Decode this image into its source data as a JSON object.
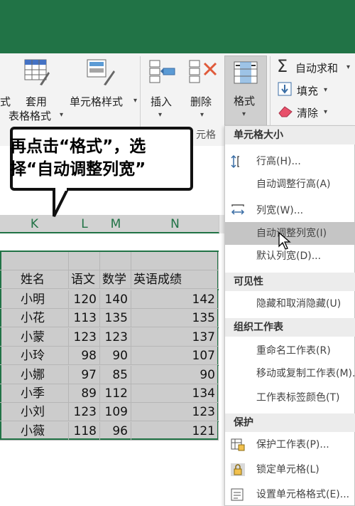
{
  "ribbon": {
    "partial_left": "式",
    "table_format_line1": "套用",
    "table_format_line2": "表格格式",
    "cell_styles": "单元格样式",
    "insert": "插入",
    "delete": "删除",
    "format": "格式",
    "autosum": "自动求和",
    "fill": "填充",
    "clear": "清除",
    "group_cells_partial": "元格"
  },
  "callout": {
    "line1": "再点击“格式”，选",
    "line2": "择“自动调整列宽”"
  },
  "columns": [
    "K",
    "L",
    "M",
    "N"
  ],
  "table": {
    "headers": [
      "姓名",
      "语文",
      "数学",
      "英语成绩"
    ],
    "rows": [
      {
        "name": "小明",
        "chinese": "120",
        "math": "140",
        "english": "142"
      },
      {
        "name": "小花",
        "chinese": "113",
        "math": "135",
        "english": "135"
      },
      {
        "name": "小蒙",
        "chinese": "123",
        "math": "123",
        "english": "137"
      },
      {
        "name": "小玲",
        "chinese": "98",
        "math": "90",
        "english": "107"
      },
      {
        "name": "小娜",
        "chinese": "97",
        "math": "85",
        "english": "90"
      },
      {
        "name": "小季",
        "chinese": "89",
        "math": "112",
        "english": "134"
      },
      {
        "name": "小刘",
        "chinese": "123",
        "math": "109",
        "english": "123"
      },
      {
        "name": "小薇",
        "chinese": "118",
        "math": "96",
        "english": "121"
      }
    ]
  },
  "menu": {
    "section_cell_size": "单元格大小",
    "row_height": "行高(H)...",
    "autofit_row_height": "自动调整行高(A)",
    "column_width": "列宽(W)...",
    "autofit_column_width": "自动调整列宽(I)",
    "default_width": "默认列宽(D)...",
    "section_visibility": "可见性",
    "hide_unhide": "隐藏和取消隐藏(U)",
    "section_organize": "组织工作表",
    "rename_sheet": "重命名工作表(R)",
    "move_copy_sheet": "移动或复制工作表(M)...",
    "tab_color": "工作表标签颜色(T)",
    "section_protect": "保护",
    "protect_sheet": "保护工作表(P)...",
    "lock_cell": "锁定单元格(L)",
    "format_cells": "设置单元格格式(E)..."
  },
  "colors": {
    "excel_green": "#217346",
    "highlight": "#c5c5c5"
  }
}
